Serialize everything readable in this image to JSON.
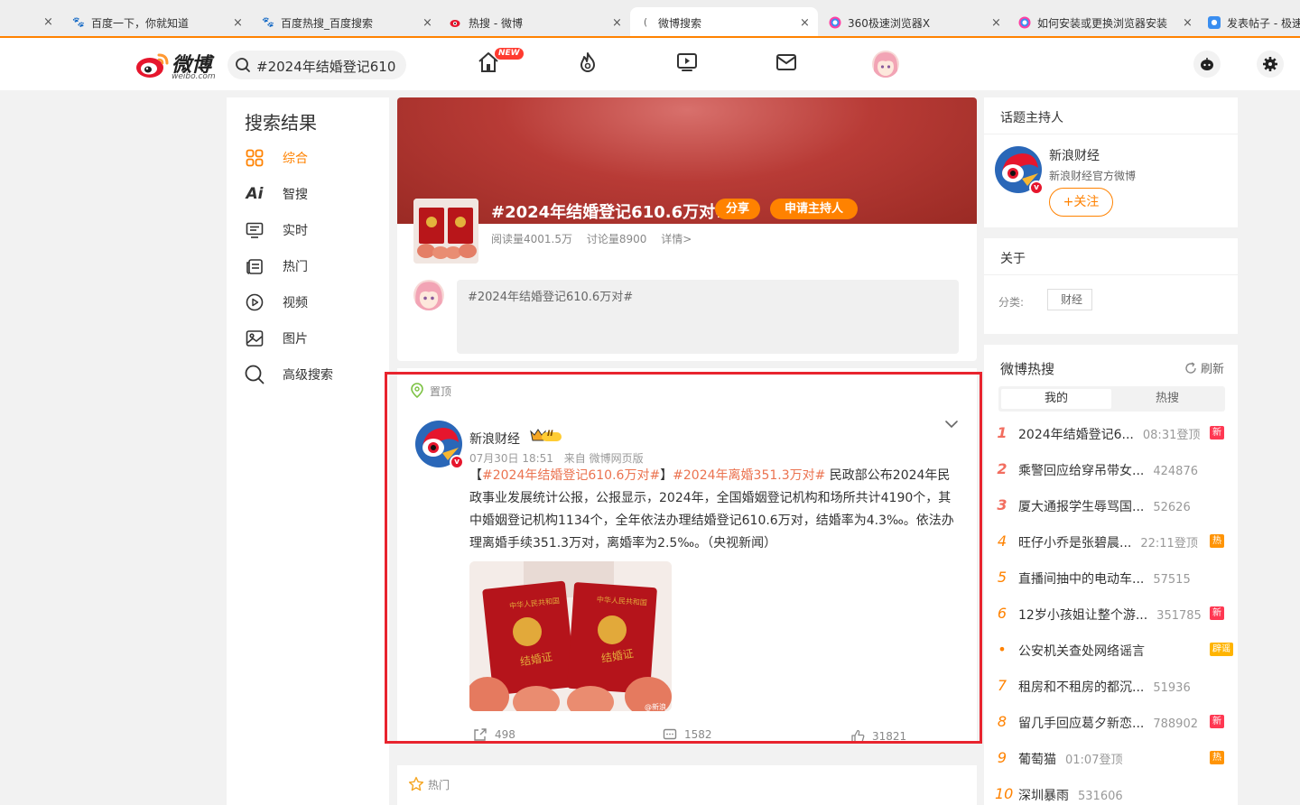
{
  "browser": {
    "tabs": [
      {
        "label": "百度一下，你就知道",
        "icon": "baidu-paw-icon"
      },
      {
        "label": "百度热搜_百度搜索",
        "icon": "baidu-paw-icon"
      },
      {
        "label": "热搜 - 微博",
        "icon": "weibo-icon"
      },
      {
        "label": "微博搜索",
        "icon": "loading-icon"
      },
      {
        "label": "360极速浏览器X",
        "icon": "360-icon"
      },
      {
        "label": "如何安装或更换浏览器安装",
        "icon": "360-icon"
      },
      {
        "label": "发表帖子 - 极速",
        "icon": "forum-icon"
      }
    ]
  },
  "header": {
    "logo_text": "微博",
    "logo_sub": "weibo.com",
    "search_value": "#2024年结婚登记610",
    "new_badge": "NEW"
  },
  "leftnav": {
    "title": "搜索结果",
    "items": [
      {
        "label": "综合",
        "icon": "grid-icon"
      },
      {
        "label": "智搜",
        "icon": "ai-icon"
      },
      {
        "label": "实时",
        "icon": "realtime-icon"
      },
      {
        "label": "热门",
        "icon": "hot-icon"
      },
      {
        "label": "视频",
        "icon": "video-icon"
      },
      {
        "label": "图片",
        "icon": "image-icon"
      },
      {
        "label": "高级搜索",
        "icon": "search-icon"
      }
    ]
  },
  "topic": {
    "title": "#2024年结婚登记610.6万对#",
    "share_label": "分享",
    "host_label": "申请主持人",
    "reads": "阅读量4001.5万",
    "discussions": "讨论量8900",
    "details": "详情>",
    "compose_placeholder": "#2024年结婚登记610.6万对#"
  },
  "post": {
    "pinned_label": "置顶",
    "author": "新浪财经",
    "level_badge": "II",
    "time": "07月30日 18:51",
    "source": "来自 微博网页版",
    "text_open": "【",
    "tag1": "#2024年结婚登记610.6万对#",
    "text_mid": "】",
    "tag2": "#2024年离婚351.3万对#",
    "body": " 民政部公布2024年民政事业发展统计公报，公报显示，2024年，全国婚姻登记机构和场所共计4190个，其中婚姻登记机构1134个，全年依法办理结婚登记610.6万对，结婚率为4.3‰。依法办理离婚手续351.3万对，离婚率为2.5‰。（央视新闻）",
    "watermark": "@新浪",
    "reposts": "498",
    "comments": "1582",
    "likes": "31821"
  },
  "hot_section_label": "热门",
  "host_card": {
    "title": "话题主持人",
    "name": "新浪财经",
    "desc": "新浪财经官方微博",
    "follow": "+关注"
  },
  "about_card": {
    "title": "关于",
    "category_label": "分类:",
    "category": "财经"
  },
  "hot_search": {
    "title": "微博热搜",
    "refresh": "刷新",
    "tab_mine": "我的",
    "tab_hot": "热搜",
    "items": [
      {
        "rank": "1",
        "title": "2024年结婚登记6...",
        "num": "08:31登顶",
        "tag": "新",
        "tag_type": "new"
      },
      {
        "rank": "2",
        "title": "乘警回应给穿吊带女...",
        "num": "424876",
        "tag": "",
        "tag_type": ""
      },
      {
        "rank": "3",
        "title": "厦大通报学生辱骂国...",
        "num": "52626",
        "tag": "",
        "tag_type": ""
      },
      {
        "rank": "4",
        "title": "旺仔小乔是张碧晨...",
        "num": "22:11登顶",
        "tag": "热",
        "tag_type": "hot"
      },
      {
        "rank": "5",
        "title": "直播间抽中的电动车...",
        "num": "57515",
        "tag": "",
        "tag_type": ""
      },
      {
        "rank": "6",
        "title": "12岁小孩姐让整个游...",
        "num": "351785",
        "tag": "新",
        "tag_type": "new"
      },
      {
        "rank": "•",
        "title": "公安机关查处网络谣言",
        "num": "",
        "tag": "辟谣",
        "tag_type": "rumor"
      },
      {
        "rank": "7",
        "title": "租房和不租房的都沉...",
        "num": "51936",
        "tag": "",
        "tag_type": ""
      },
      {
        "rank": "8",
        "title": "留几手回应葛夕新恋...",
        "num": "788902",
        "tag": "新",
        "tag_type": "new"
      },
      {
        "rank": "9",
        "title": "葡萄猫",
        "num": "01:07登顶",
        "tag": "热",
        "tag_type": "hot"
      },
      {
        "rank": "10",
        "title": "深圳暴雨",
        "num": "531606",
        "tag": "",
        "tag_type": ""
      }
    ]
  }
}
